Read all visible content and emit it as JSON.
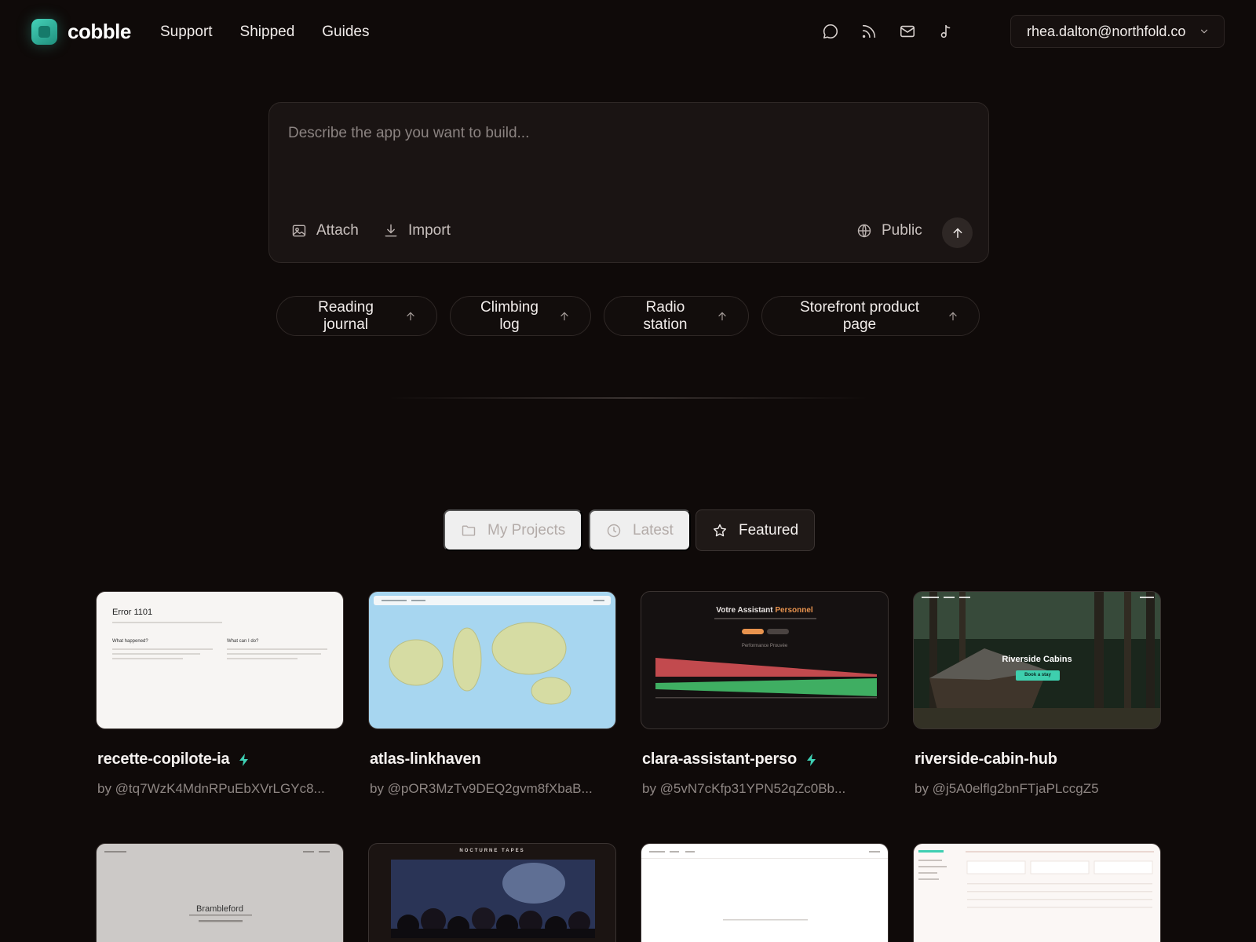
{
  "brand": {
    "name": "cobble",
    "accent": "#3ecfb2"
  },
  "nav": {
    "items": [
      "Support",
      "Shipped",
      "Guides"
    ]
  },
  "header_icons": [
    "chat-bubble-icon",
    "rss-icon",
    "mail-icon",
    "music-note-icon"
  ],
  "account": {
    "email": "rhea.dalton@northfold.co"
  },
  "composer": {
    "placeholder": "Describe the app you want to build...",
    "attach_label": "Attach",
    "import_label": "Import",
    "visibility_label": "Public"
  },
  "suggestions": [
    "Reading journal",
    "Climbing log",
    "Radio station",
    "Storefront product page"
  ],
  "tabs": [
    {
      "label": "My Projects",
      "icon": "folder-icon",
      "active": false
    },
    {
      "label": "Latest",
      "icon": "clock-icon",
      "active": false
    },
    {
      "label": "Featured",
      "icon": "star-icon",
      "active": true
    }
  ],
  "projects": [
    {
      "title": "recette-copilote-ia",
      "author": "by @tq7WzK4MdnRPuEbXVrLGYc8...",
      "bolt": true,
      "preview": {
        "heading": "Error 1101",
        "col1": "What happened?",
        "col2": "What can I do?"
      }
    },
    {
      "title": "atlas-linkhaven",
      "author": "by @pOR3MzTv9DEQ2gvm8fXbaB...",
      "bolt": false,
      "preview": {}
    },
    {
      "title": "clara-assistant-perso",
      "author": "by @5vN7cKfp31YPN52qZc0Bb...",
      "bolt": true,
      "preview": {
        "heading_a": "Votre Assistant",
        "heading_b": "Personnel",
        "subheading": "Performance Prouvée"
      }
    },
    {
      "title": "riverside-cabin-hub",
      "author": "by @j5A0elflg2bnFTjaPLccgZ5",
      "bolt": false,
      "preview": {
        "heading": "Riverside Cabins",
        "cta": "Book a stay"
      }
    }
  ],
  "projects_row2": [
    {
      "preview": {
        "heading": "Brambleford"
      }
    },
    {
      "preview": {
        "heading": "NOCTURNE TAPES"
      }
    },
    {
      "preview": {}
    },
    {
      "preview": {}
    }
  ]
}
